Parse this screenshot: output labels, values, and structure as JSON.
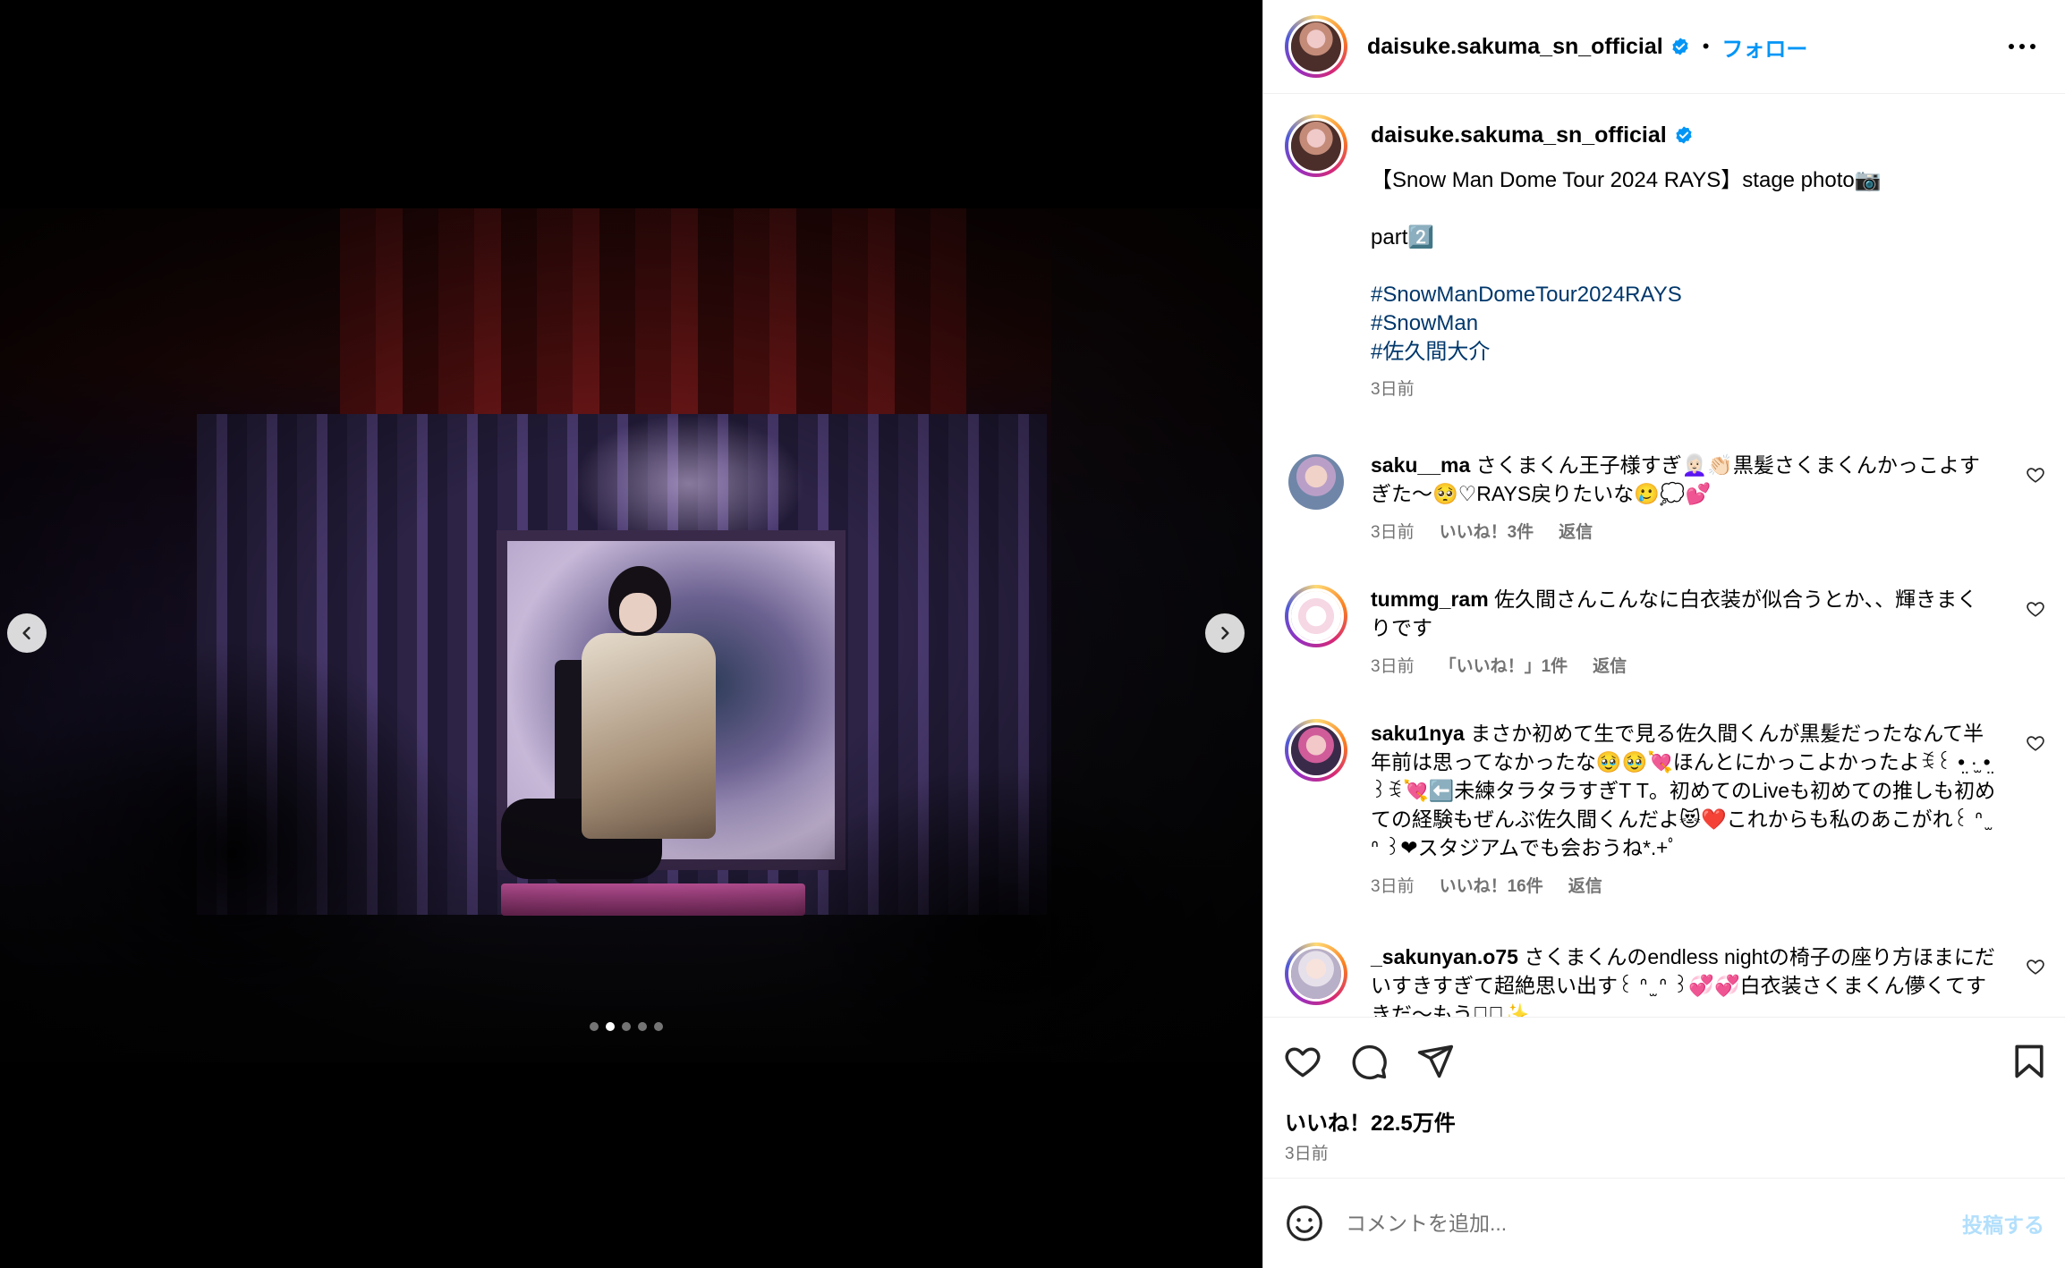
{
  "header": {
    "username": "daisuke.sakuma_sn_official",
    "separator": "•",
    "follow_label": "フォロー"
  },
  "carousel": {
    "slide_count": 5,
    "active_slide": 2
  },
  "caption": {
    "username": "daisuke.sakuma_sn_official",
    "line1": "【Snow Man Dome Tour 2024 RAYS】stage photo📷",
    "line2": "part2️⃣",
    "hashtags": [
      "#SnowManDomeTour2024RAYS",
      "#SnowMan",
      "#佐久間大介"
    ],
    "time": "3日前"
  },
  "comments": [
    {
      "username": "saku__ma",
      "text": "さくまくん王子様すぎ👩🏻‍🦳👏🏻黒髪さくまくんかっこよすぎた〜🥺♡RAYS戻りたいな🥲💭💕",
      "time": "3日前",
      "likes": "いいね！3件",
      "reply": "返信"
    },
    {
      "username": "tummg_ram",
      "text": "佐久間さんこんなに白衣装が似合うとか、、輝きまくりです",
      "time": "3日前",
      "likes": "「いいね！」1件",
      "reply": "返信"
    },
    {
      "username": "saku1nya",
      "text": "まさか初めて生で見る佐久間くんが黒髪だったなんて半年前は思ってなかったな🥹🥹💘ほんとにかっこよかったよꉂ꒰ •̤ ·̫ •̤ ꒱ꉂ💘⬅️未練タラタラすぎT T。初めてのLiveも初めての推しも初めての経験もぜんぶ佐久間くんだよ😻❤️これからも私のあこがれ꒰ ᐢ ̫ ᐢ ꒱❤スタジアムでも会おうね*.+ﾟ",
      "time": "3日前",
      "likes": "いいね！16件",
      "reply": "返信"
    },
    {
      "username": "_sakunyan.o75",
      "text": "さくまくんのendless nightの椅子の座り方ほまにだいすきすぎて超絶思い出す꒰ ᐢ ̫ ᐢ ꒱💞💞白衣装さくまくん儚くてすきだ〜もう〜🏻✨",
      "time": "3日前",
      "likes": "",
      "reply": ""
    }
  ],
  "actions": {
    "likes": "いいね！22.5万件",
    "time": "3日前"
  },
  "comment_box": {
    "placeholder": "コメントを追加...",
    "post_label": "投稿する"
  },
  "colors": {
    "link_blue": "#0095f6",
    "hashtag": "#00376b",
    "muted": "#737373",
    "post_disabled": "#b2dffc"
  }
}
